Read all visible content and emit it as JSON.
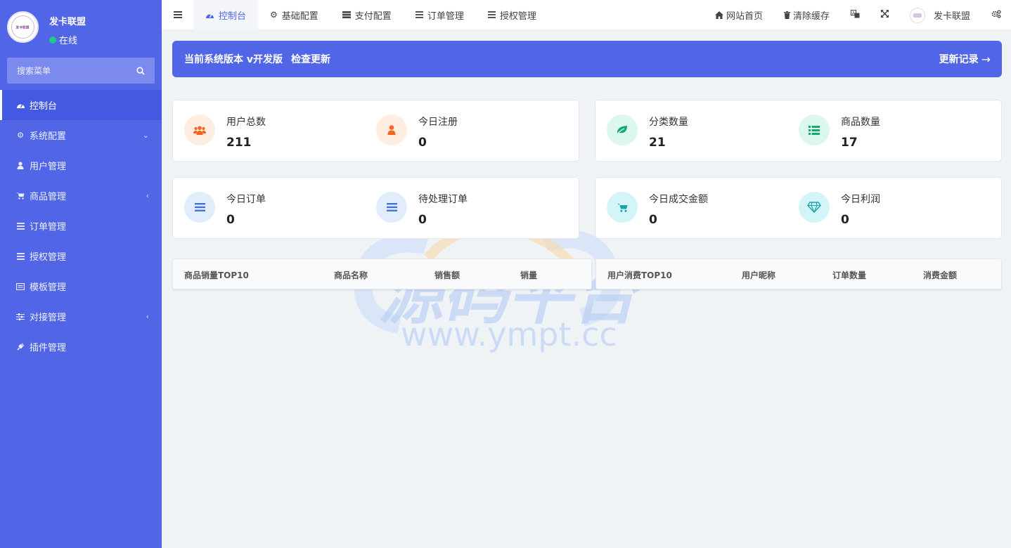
{
  "sidebar": {
    "brand_name": "发卡联盟",
    "status": "在线",
    "avatar_text": "发卡联盟",
    "search_placeholder": "搜索菜单",
    "items": [
      {
        "label": "控制台"
      },
      {
        "label": "系统配置"
      },
      {
        "label": "用户管理"
      },
      {
        "label": "商品管理"
      },
      {
        "label": "订单管理"
      },
      {
        "label": "授权管理"
      },
      {
        "label": "模板管理"
      },
      {
        "label": "对接管理"
      },
      {
        "label": "插件管理"
      }
    ]
  },
  "navbar": {
    "tabs": [
      {
        "label": "控制台"
      },
      {
        "label": "基础配置"
      },
      {
        "label": "支付配置"
      },
      {
        "label": "订单管理"
      },
      {
        "label": "授权管理"
      }
    ],
    "right": {
      "home": "网站首页",
      "clear_cache": "清除缓存",
      "user": "发卡联盟"
    }
  },
  "banner": {
    "version_text": "当前系统版本 v开发版",
    "check_update": "检查更新",
    "changelog": "更新记录",
    "arrow": "→"
  },
  "stats": {
    "total_users": {
      "label": "用户总数",
      "value": "211"
    },
    "today_register": {
      "label": "今日注册",
      "value": "0"
    },
    "category_count": {
      "label": "分类数量",
      "value": "21"
    },
    "product_count": {
      "label": "商品数量",
      "value": "17"
    },
    "today_orders": {
      "label": "今日订单",
      "value": "0"
    },
    "pending_orders": {
      "label": "待处理订单",
      "value": "0"
    },
    "today_turnover": {
      "label": "今日成交金额",
      "value": "0"
    },
    "today_profit": {
      "label": "今日利润",
      "value": "0"
    }
  },
  "tables": {
    "products": {
      "headers": [
        "商品销量TOP10",
        "商品名称",
        "销售额",
        "销量"
      ]
    },
    "users": {
      "headers": [
        "用户消费TOP10",
        "用户昵称",
        "订单数量",
        "消费金额"
      ]
    }
  },
  "watermark": {
    "title": "源码平台",
    "url": "www.ympt.cc"
  },
  "colors": {
    "sidebar": "#5166e6",
    "accent": "#5166e6",
    "orange": "#f26522",
    "green": "#17a871",
    "blue": "#3f6fd8",
    "cyan": "#17a3ad"
  }
}
